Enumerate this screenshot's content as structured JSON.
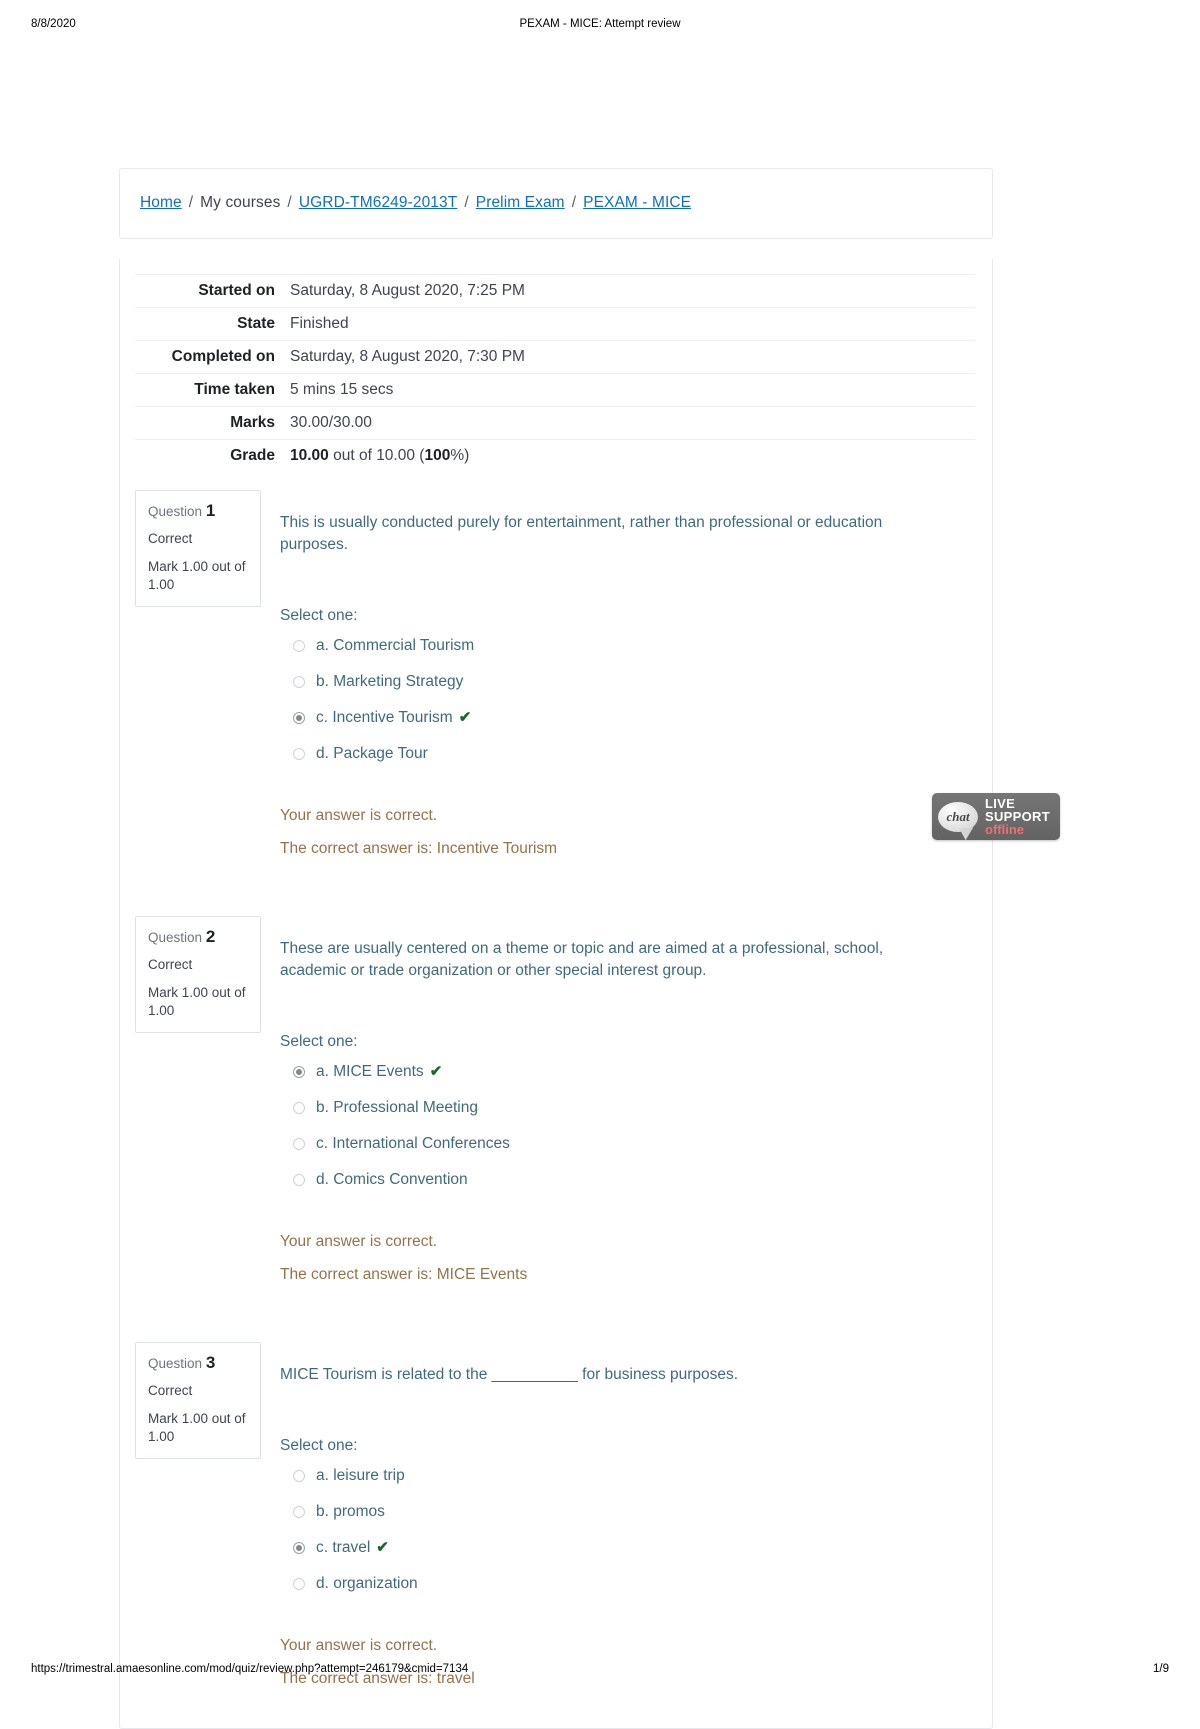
{
  "print_header": {
    "date": "8/8/2020",
    "title": "PEXAM - MICE: Attempt review"
  },
  "print_footer": {
    "url": "https://trimestral.amaesonline.com/mod/quiz/review.php?attempt=246179&cmid=7134",
    "page": "1/9"
  },
  "breadcrumb": {
    "items": [
      {
        "label": "Home",
        "link": true
      },
      {
        "label": "My courses",
        "link": false
      },
      {
        "label": "UGRD-TM6249-2013T",
        "link": true
      },
      {
        "label": "Prelim Exam",
        "link": true
      },
      {
        "label": "PEXAM - MICE",
        "link": true
      }
    ],
    "separator": "/"
  },
  "summary": {
    "rows": [
      {
        "label": "Started on",
        "value": "Saturday, 8 August 2020, 7:25 PM"
      },
      {
        "label": "State",
        "value": "Finished"
      },
      {
        "label": "Completed on",
        "value": "Saturday, 8 August 2020, 7:30 PM"
      },
      {
        "label": "Time taken",
        "value": "5 mins 15 secs"
      },
      {
        "label": "Marks",
        "value": "30.00/30.00"
      }
    ],
    "grade": {
      "label": "Grade",
      "score": "10.00",
      "middle": " out of 10.00 (",
      "percent": "100",
      "suffix": "%)"
    }
  },
  "questions": [
    {
      "number_label": "Question",
      "number": "1",
      "state": "Correct",
      "grade": "Mark 1.00 out of 1.00",
      "text": "This is usually conducted purely for entertainment, rather than professional or education purposes.",
      "prompt": "Select one:",
      "options": [
        {
          "label": "a. Commercial Tourism",
          "selected": false,
          "correct": false
        },
        {
          "label": "b. Marketing Strategy",
          "selected": false,
          "correct": false
        },
        {
          "label": "c. Incentive Tourism",
          "selected": true,
          "correct": true
        },
        {
          "label": "d. Package Tour",
          "selected": false,
          "correct": false
        }
      ],
      "feedback": "Your answer is correct.",
      "correct_answer": "The correct answer is: Incentive Tourism"
    },
    {
      "number_label": "Question",
      "number": "2",
      "state": "Correct",
      "grade": "Mark 1.00 out of 1.00",
      "text": "These are usually centered on a theme or topic and are aimed at a professional, school, academic or trade organization or other special interest group.",
      "prompt": "Select one:",
      "options": [
        {
          "label": "a. MICE Events",
          "selected": true,
          "correct": true
        },
        {
          "label": "b. Professional Meeting",
          "selected": false,
          "correct": false
        },
        {
          "label": "c. International Conferences",
          "selected": false,
          "correct": false
        },
        {
          "label": "d. Comics Convention",
          "selected": false,
          "correct": false
        }
      ],
      "feedback": "Your answer is correct.",
      "correct_answer": "The correct answer is: MICE Events"
    },
    {
      "number_label": "Question",
      "number": "3",
      "state": "Correct",
      "grade": "Mark 1.00 out of 1.00",
      "text": "MICE Tourism is related to the __________ for business purposes.",
      "prompt": "Select one:",
      "options": [
        {
          "label": "a. leisure trip",
          "selected": false,
          "correct": false
        },
        {
          "label": "b. promos",
          "selected": false,
          "correct": false
        },
        {
          "label": "c. travel",
          "selected": true,
          "correct": true
        },
        {
          "label": "d. organization",
          "selected": false,
          "correct": false
        }
      ],
      "feedback": "Your answer is correct.",
      "correct_answer": "The correct answer is: travel"
    }
  ],
  "chat_widget": {
    "icon_text": "chat",
    "line1": "LIVE",
    "line2": "SUPPORT",
    "line3": "offline"
  },
  "icons": {
    "tick": "✔"
  }
}
